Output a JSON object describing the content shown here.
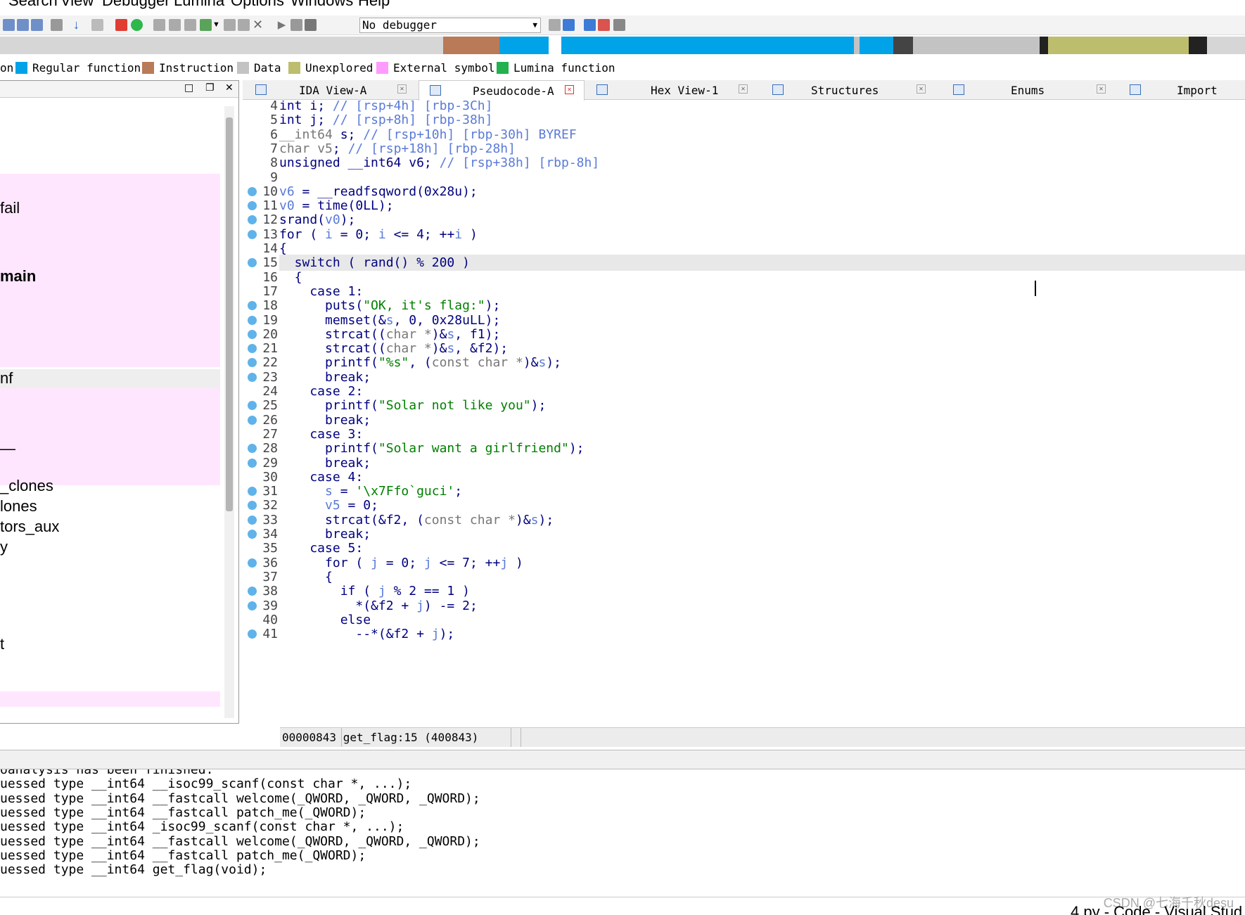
{
  "menu": [
    "Search",
    "View",
    "Debugger",
    "Lumina",
    "Options",
    "Windows",
    "Help"
  ],
  "toolbar": {
    "debugger_select": "No debugger"
  },
  "legend": [
    {
      "label": "on",
      "color": ""
    },
    {
      "label": "Regular function",
      "color": "#00a2e8"
    },
    {
      "label": "Instruction",
      "color": "#b97a57"
    },
    {
      "label": "Data",
      "color": "#c3c3c3"
    },
    {
      "label": "Unexplored",
      "color": "#bdbd6e"
    },
    {
      "label": "External symbol",
      "color": "#ff9bff"
    },
    {
      "label": "Lumina function",
      "color": "#22b14c"
    }
  ],
  "functions_panel": {
    "items": [
      "fail",
      "main",
      "nf",
      "—",
      "_clones",
      "lones",
      "tors_aux",
      "y",
      "t"
    ]
  },
  "tabs": [
    "IDA View-A",
    "Pseudocode-A",
    "Hex View-1",
    "Structures",
    "Enums",
    "Import"
  ],
  "code": {
    "line_numbers": [
      "4",
      "5",
      "6",
      "7",
      "8",
      "9",
      "10",
      "11",
      "12",
      "13",
      "14",
      "15",
      "16",
      "17",
      "18",
      "19",
      "20",
      "21",
      "22",
      "23",
      "24",
      "25",
      "26",
      "27",
      "28",
      "29",
      "30",
      "31",
      "32",
      "33",
      "34",
      "35",
      "36",
      "37",
      "38",
      "39",
      "40",
      "41"
    ]
  },
  "status": {
    "location": "00000843 get_flag:15 (400843)"
  },
  "output": {
    "lines": [
      "oanalysis has been finished.",
      "uessed type __int64 __isoc99_scanf(const char *, ...);",
      "uessed type __int64 __fastcall welcome(_QWORD, _QWORD, _QWORD);",
      "uessed type __int64 __fastcall patch_me(_QWORD);",
      "uessed type __int64 _isoc99_scanf(const char *, ...);",
      "uessed type __int64 __fastcall welcome(_QWORD, _QWORD, _QWORD);",
      "uessed type __int64 __fastcall patch_me(_QWORD);",
      "uessed type __int64 get_flag(void);"
    ]
  },
  "watermark": "CSDN @七海千秋desu",
  "taskbar": {
    "vscode": "4.py - Code - Visual Stud"
  },
  "colors": {
    "breakpoint": "#5fb3ea",
    "keyword": "#000080",
    "variable": "#5a7ad8",
    "string": "#008000"
  }
}
